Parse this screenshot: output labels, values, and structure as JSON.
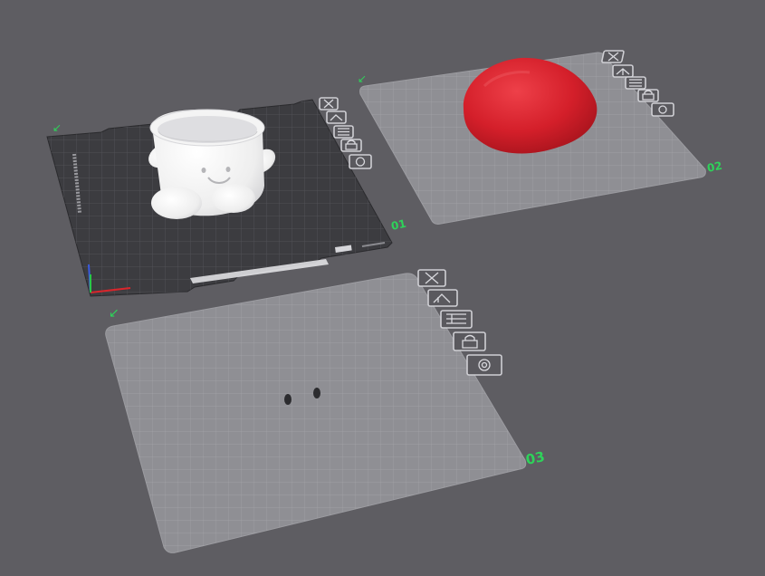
{
  "plates": [
    {
      "id": "plate-1",
      "label": "01",
      "arrow": "↙",
      "style": "textured-dark",
      "object": "white-planter-pot"
    },
    {
      "id": "plate-2",
      "label": "02",
      "arrow": "↙",
      "style": "light-grid",
      "object": "red-blob"
    },
    {
      "id": "plate-3",
      "label": "03",
      "arrow": "↙",
      "style": "light-grid",
      "object": "two-small-parts"
    }
  ],
  "plate_tools": [
    {
      "name": "close-plate",
      "icon": "close-icon"
    },
    {
      "name": "auto-orient",
      "icon": "orient-icon"
    },
    {
      "name": "arrange",
      "icon": "arrange-icon"
    },
    {
      "name": "lock-plate",
      "icon": "lock-icon"
    },
    {
      "name": "plate-settings",
      "icon": "gear-icon"
    }
  ],
  "colors": {
    "background": "#5e5d62",
    "plate_label": "#2ed35a",
    "dark_plate": "#3a3a3e",
    "light_plate": "#8e8e93",
    "red_object": "#d9232f",
    "white_object": "#f2f2f2"
  }
}
